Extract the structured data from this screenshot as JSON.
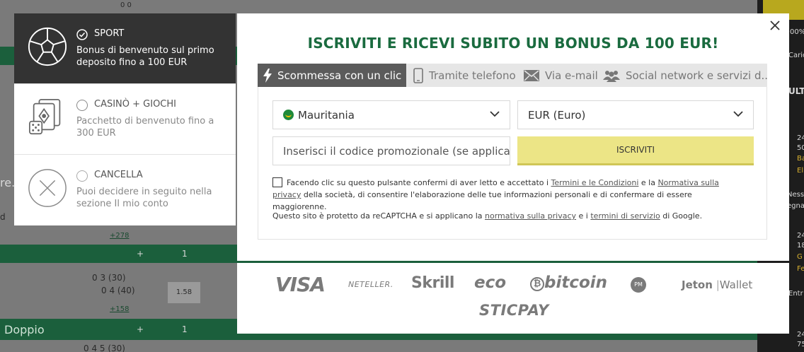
{
  "background": {
    "top_scores": "0  0",
    "doppio_label": "Doppio",
    "partial_label": "re. S",
    "partial_label2": "d",
    "odds_1": "1.58",
    "count_link_1": "+278",
    "count_link_2": "+158",
    "plus_sign": "+",
    "one": "1",
    "score_row_1": "0  3  (30)",
    "score_row_2": "0  4  (40)",
    "score_row_3": "0  4  5  (30)",
    "right_snips": [
      "00%",
      "Cario",
      "ULT",
      "24",
      "50",
      "Ba",
      "El",
      "Ness",
      "egna",
      "24",
      "18",
      "G",
      "Fe",
      "Entr",
      "24",
      "75"
    ]
  },
  "options": [
    {
      "title": "SPORT",
      "desc": "Bonus di benvenuto sul primo deposito fino a 100 EUR",
      "icon": "soccer-ball-icon",
      "selected": true
    },
    {
      "title": "CASINÒ + GIOCHI",
      "desc": "Pacchetto di benvenuto fino a 300 EUR",
      "icon": "casino-cards-icon",
      "selected": false
    },
    {
      "title": "CANCELLA",
      "desc": "Puoi decidere in seguito nella sezione Il mio conto",
      "icon": "cancel-x-icon",
      "selected": false
    }
  ],
  "modal": {
    "title": "ISCRIVITI E RICEVI SUBITO UN BONUS DA 100 EUR!",
    "tabs": [
      {
        "label": "Scommessa con un clic",
        "icon": "lightning-icon"
      },
      {
        "label": "Tramite telefono",
        "icon": "phone-icon"
      },
      {
        "label": "Via e-mail",
        "icon": "envelope-icon"
      },
      {
        "label": "Social network e servizi d...",
        "icon": "users-icon"
      }
    ],
    "country": "Mauritania",
    "currency": "EUR (Euro)",
    "promo_placeholder": "Inserisci il codice promozionale (se applicabile)",
    "submit_label": "ISCRIVITI",
    "terms": {
      "pre": "Facendo clic su questo pulsante confermi di aver letto e accettato i ",
      "link1": "Termini e le Condizioni",
      "mid": " e la ",
      "link2": "Normativa sulla privacy",
      "post": " della società, di consentire l'elaborazione delle tue informazioni personali e di confermare di essere maggiorenne."
    },
    "recaptcha": {
      "pre": "Questo sito è protetto da reCAPTCHA e si applicano la ",
      "link1": "normativa sulla privacy",
      "mid": " e i ",
      "link2": "termini di servizio",
      "post": " di Google."
    }
  },
  "payments": {
    "visa": "VISA",
    "neteller": "NETELLER.",
    "skrill": "Skrill",
    "eco": "eco",
    "bitcoin": "bitcoin",
    "pm": "PM",
    "jeton_bold": "Jeton",
    "jeton_sep": "|",
    "jeton_rest": "Wallet",
    "sticpay": "STICPAY"
  },
  "colors": {
    "accent_green": "#1a6b3f",
    "submit_yellow": "#ece586",
    "active_dark": "#333333"
  }
}
